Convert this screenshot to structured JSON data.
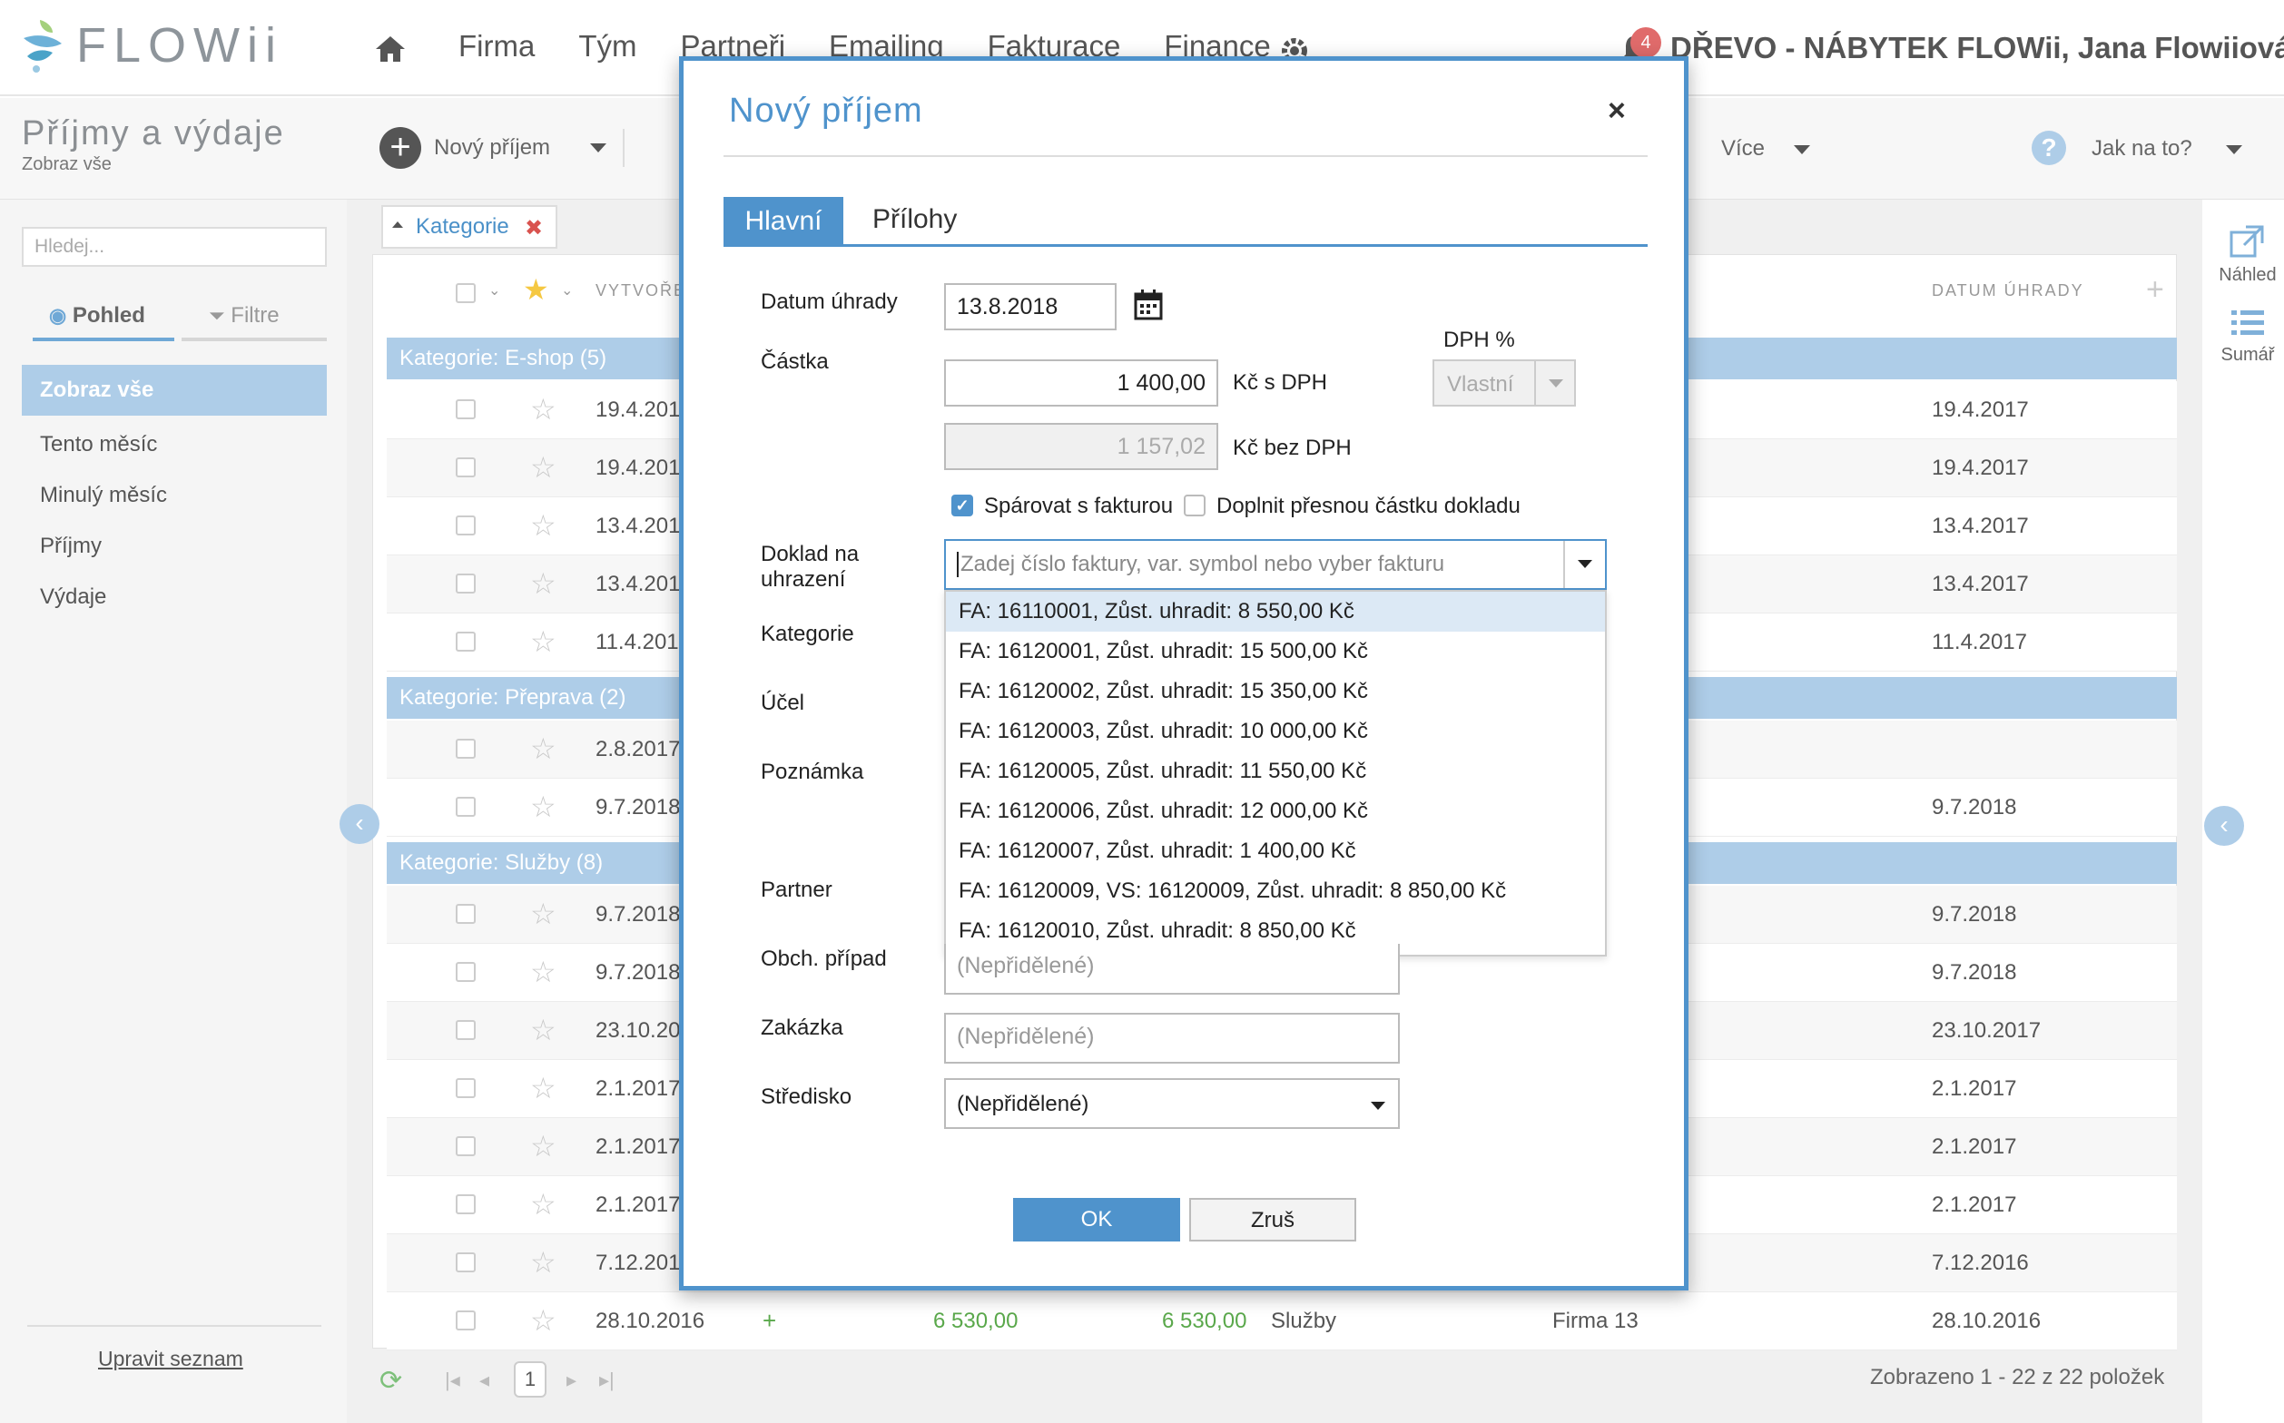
{
  "header": {
    "logo_text": "FLOWii",
    "nav": [
      "Firma",
      "Tým",
      "Partneři",
      "Emailing",
      "Fakturace",
      "Finance"
    ],
    "notification_count": "4",
    "company_user": "DŘEVO - NÁBYTEK FLOWii, Jana Flowiiová"
  },
  "page": {
    "title": "Příjmy a výdaje",
    "subtitle": "Zobraz vše"
  },
  "sidebar": {
    "search_placeholder": "Hledej...",
    "tab_view": "Pohled",
    "tab_filters": "Filtre",
    "items": [
      "Zobraz vše",
      "Tento měsíc",
      "Minulý měsíc",
      "Příjmy",
      "Výdaje"
    ],
    "edit_list": "Upravit seznam"
  },
  "toolbar": {
    "new_income": "Nový příjem",
    "more": "Více",
    "howto": "Jak na to?",
    "preview": "Náhled",
    "summary": "Sumář"
  },
  "grid": {
    "filter_chip": "Kategorie",
    "col_created": "VYTVOŘE",
    "col_due": "DATUM ÚHRADY",
    "groups": [
      "Kategorie: E-shop (5)",
      "Kategorie: Přeprava (2)",
      "Kategorie: Služby (8)"
    ],
    "rows": [
      {
        "date": "19.4.201",
        "due": "19.4.2017"
      },
      {
        "date": "19.4.201",
        "due": "19.4.2017"
      },
      {
        "date": "13.4.201",
        "due": "13.4.2017"
      },
      {
        "date": "13.4.201",
        "due": "13.4.2017"
      },
      {
        "date": "11.4.201",
        "due": "11.4.2017"
      },
      {
        "date": "2.8.2017",
        "due": ""
      },
      {
        "date": "9.7.2018",
        "due": "9.7.2018"
      },
      {
        "date": "9.7.2018",
        "due": "9.7.2018"
      },
      {
        "date": "9.7.2018",
        "due": "9.7.2018"
      },
      {
        "date": "23.10.20",
        "due": "23.10.2017"
      },
      {
        "date": "2.1.2017",
        "due": "2.1.2017"
      },
      {
        "date": "2.1.2017",
        "due": "2.1.2017"
      },
      {
        "date": "2.1.2017",
        "due": "2.1.2017"
      },
      {
        "date": "7.12.201",
        "due": "7.12.2016"
      },
      {
        "date": "28.10.2016",
        "due": "28.10.2016",
        "plus": "+",
        "amount1": "6 530,00",
        "amount2": "6 530,00",
        "category": "Služby",
        "firm": "Firma 13"
      }
    ],
    "page_number": "1",
    "page_info": "Zobrazeno 1 - 22 z 22 položek"
  },
  "modal": {
    "title": "Nový příjem",
    "close": "×",
    "tab_main": "Hlavní",
    "tab_attachments": "Přílohy",
    "labels": {
      "payment_date": "Datum úhrady",
      "amount": "Částka",
      "vat": "DPH %",
      "doc_line1": "Doklad na",
      "doc_line2": "uhrazení",
      "category": "Kategorie",
      "purpose": "Účel",
      "note": "Poznámka",
      "partner": "Partner",
      "business_case": "Obch. případ",
      "order": "Zakázka",
      "center": "Středisko"
    },
    "payment_date_value": "13.8.2018",
    "amount_with_vat": "1 400,00",
    "amount_without_vat": "1 157,02",
    "unit_with_vat": "Kč  s DPH",
    "unit_without_vat": "Kč  bez DPH",
    "vat_select": "Vlastní",
    "pair_with_invoice": "Spárovat s fakturou",
    "fill_exact_amount": "Doplnit přesnou částku dokladu",
    "doc_placeholder": "Zadej číslo faktury, var. symbol nebo vyber fakturu",
    "invoice_options": [
      "FA: 16110001, Zůst. uhradit: 8 550,00 Kč",
      "FA: 16120001, Zůst. uhradit: 15 500,00 Kč",
      "FA: 16120002, Zůst. uhradit: 15 350,00 Kč",
      "FA: 16120003, Zůst. uhradit: 10 000,00 Kč",
      "FA: 16120005, Zůst. uhradit: 11 550,00 Kč",
      "FA: 16120006, Zůst. uhradit: 12 000,00 Kč",
      "FA: 16120007, Zůst. uhradit: 1 400,00 Kč",
      "FA: 16120009, VS: 16120009, Zůst. uhradit: 8 850,00 Kč",
      "FA: 16120010, Zůst. uhradit: 8 850,00 Kč"
    ],
    "unassigned": "(Nepřidělené)",
    "ok": "OK",
    "cancel": "Zruš"
  },
  "colors": {
    "accent": "#4f93cc",
    "group_bg": "#aecde8",
    "positive": "#5aa84b"
  }
}
